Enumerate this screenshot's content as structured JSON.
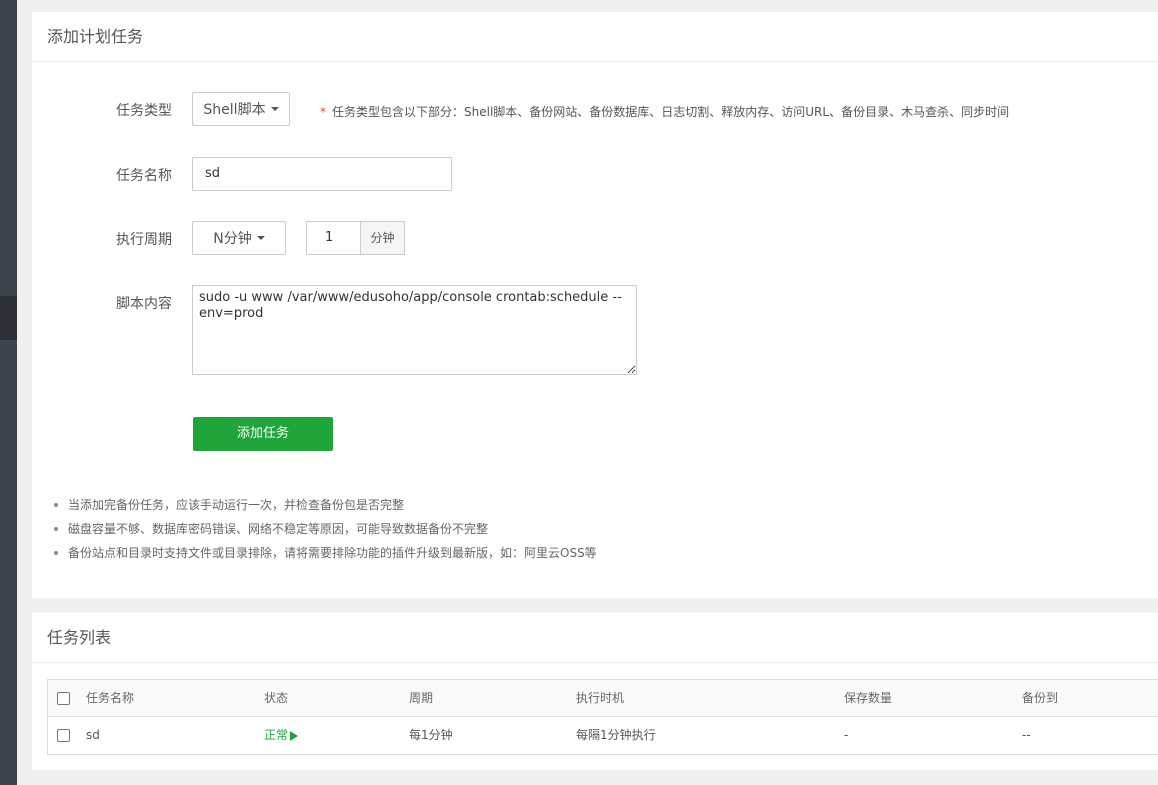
{
  "add_panel": {
    "title": "添加计划任务",
    "task_type": {
      "label": "任务类型",
      "value": "Shell脚本",
      "hint_star": "*",
      "hint": "任务类型包含以下部分：Shell脚本、备份网站、备份数据库、日志切割、释放内存、访问URL、备份目录、木马查杀、同步时间"
    },
    "task_name": {
      "label": "任务名称",
      "value": "sd"
    },
    "cycle": {
      "label": "执行周期",
      "type_value": "N分钟",
      "minutes_value": "1",
      "unit": "分钟"
    },
    "script": {
      "label": "脚本内容",
      "value": "sudo -u www /var/www/edusoho/app/console crontab:schedule --env=prod"
    },
    "submit_label": "添加任务",
    "notes": [
      "当添加完备份任务，应该手动运行一次，并检查备份包是否完整",
      "磁盘容量不够、数据库密码错误、网络不稳定等原因，可能导致数据备份不完整",
      "备份站点和目录时支持文件或目录排除，请将需要排除功能的插件升级到最新版，如：阿里云OSS等"
    ]
  },
  "list_panel": {
    "title": "任务列表",
    "columns": [
      "任务名称",
      "状态",
      "周期",
      "执行时机",
      "保存数量",
      "备份到"
    ],
    "rows": [
      {
        "name": "sd",
        "status": "正常",
        "cycle": "每1分钟",
        "timing": "每隔1分钟执行",
        "keep": "-",
        "backup_to": "--"
      }
    ]
  },
  "colors": {
    "accent": "#20a53a",
    "hint_star": "#e0443f",
    "sidebar": "#3c444d"
  },
  "icons": {
    "status": "play-triangle-icon",
    "dropdown": "caret-down-icon"
  }
}
